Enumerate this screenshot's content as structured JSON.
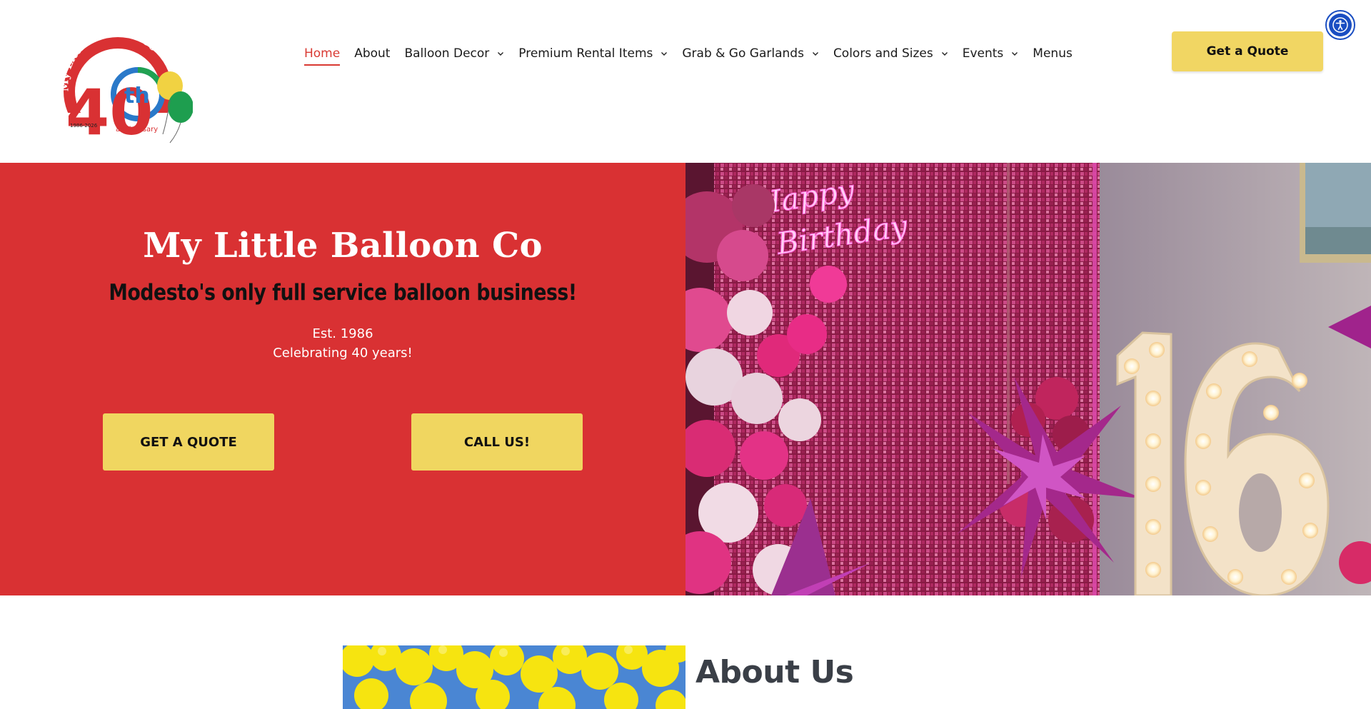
{
  "logo": {
    "top_text": "My Little Balloon Co",
    "years": "1986-2026",
    "number": "40",
    "suffix": "th",
    "tagline": "anniversary"
  },
  "nav": {
    "items": [
      {
        "label": "Home",
        "active": true,
        "dropdown": false
      },
      {
        "label": "About",
        "active": false,
        "dropdown": false
      },
      {
        "label": "Balloon Decor",
        "active": false,
        "dropdown": true
      },
      {
        "label": "Premium Rental Items",
        "active": false,
        "dropdown": true
      },
      {
        "label": "Grab & Go Garlands",
        "active": false,
        "dropdown": true
      },
      {
        "label": "Colors and Sizes",
        "active": false,
        "dropdown": true
      },
      {
        "label": "Events",
        "active": false,
        "dropdown": true
      },
      {
        "label": "Menus",
        "active": false,
        "dropdown": false
      }
    ]
  },
  "header": {
    "quote_label": "Get a Quote"
  },
  "hero": {
    "title": "My Little Balloon Co",
    "subtitle": "Modesto's only full service balloon business!",
    "est": "Est. 1986",
    "celebrating": "Celebrating 40 years!",
    "quote_button": "GET A QUOTE",
    "call_button": "CALL US!",
    "photo": {
      "neon_line1": "Happy",
      "neon_line2": "Birthday",
      "marquee_number": "16"
    }
  },
  "about": {
    "title": "About Us"
  },
  "colors": {
    "brand_red": "#d93133",
    "accent_yellow": "#f1d663",
    "nav_active": "#d93a33",
    "a11y_blue": "#1a4ec2"
  }
}
